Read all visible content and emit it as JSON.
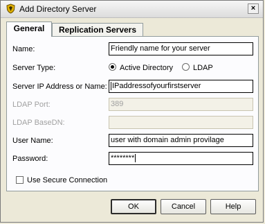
{
  "window": {
    "title": "Add Directory Server",
    "close_label": "×"
  },
  "tabs": [
    {
      "label": "General",
      "active": true
    },
    {
      "label": "Replication Servers",
      "active": false
    }
  ],
  "form": {
    "name": {
      "label": "Name:",
      "value": "Friendly name for your server"
    },
    "server_type": {
      "label": "Server Type:",
      "options": [
        "Active Directory",
        "LDAP"
      ],
      "selected": "Active Directory"
    },
    "server_ip": {
      "label": "Server IP Address or Name:",
      "value": "IPaddressofyourfirstserver"
    },
    "ldap_port": {
      "label": "LDAP Port:",
      "value": "389",
      "disabled": true
    },
    "ldap_basedn": {
      "label": "LDAP BaseDN:",
      "value": "",
      "disabled": true
    },
    "user_name": {
      "label": "User Name:",
      "value": "user with domain admin provilage"
    },
    "password": {
      "label": "Password:",
      "value": "********"
    },
    "secure": {
      "label": "Use Secure Connection",
      "checked": false
    }
  },
  "buttons": {
    "ok": "OK",
    "cancel": "Cancel",
    "help": "Help"
  },
  "colors": {
    "dialog_bg": "#ece9d8",
    "panel_bg": "#fcfcfe",
    "disabled_text": "#a0a0a0"
  }
}
